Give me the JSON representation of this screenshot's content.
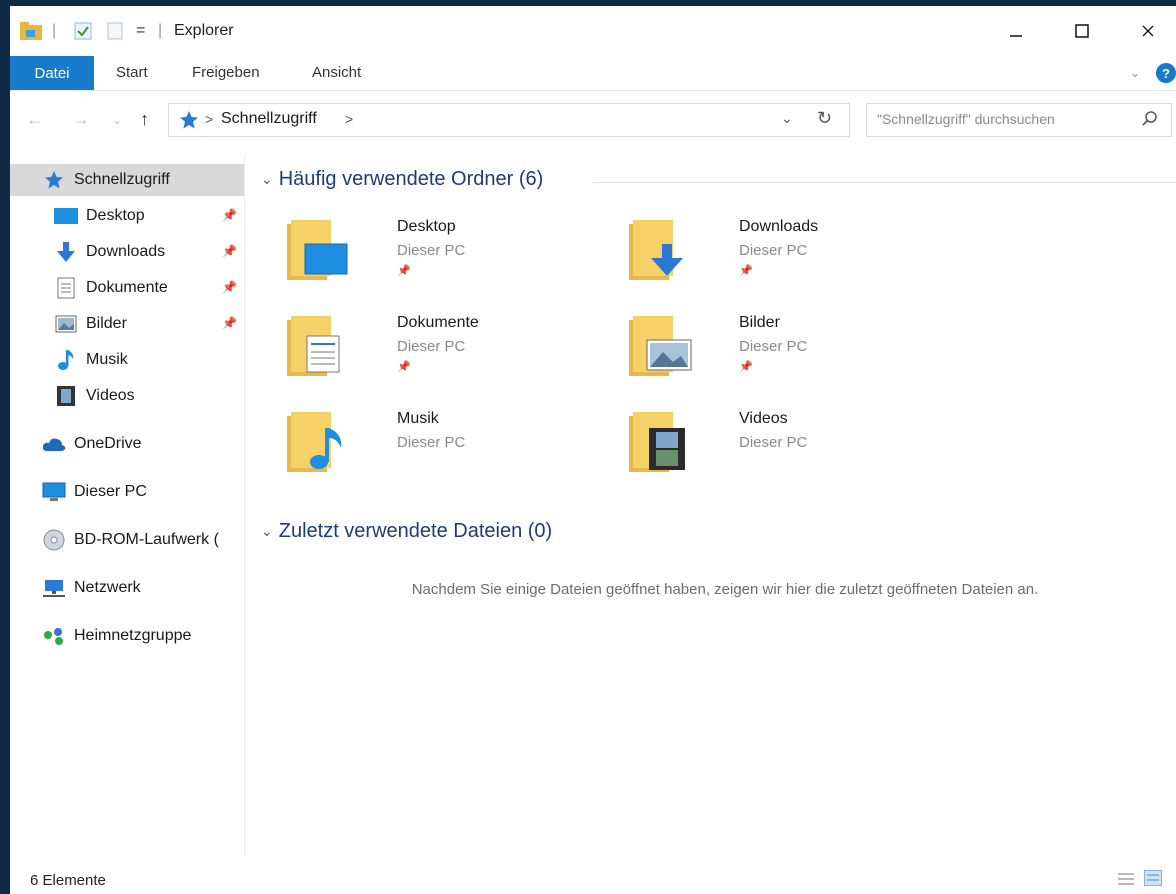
{
  "window": {
    "title": "Explorer"
  },
  "ribbon": {
    "tabs": [
      "Datei",
      "Start",
      "Freigeben",
      "Ansicht"
    ],
    "help_label": "?"
  },
  "address": {
    "path": "Schnellzugriff",
    "separator": ">",
    "search_placeholder": "\"Schnellzugriff\" durchsuchen"
  },
  "sidebar": {
    "items": [
      {
        "label": "Schnellzugriff",
        "icon": "star-icon",
        "pinned": false
      },
      {
        "label": "Desktop",
        "icon": "desktop-icon",
        "pinned": true
      },
      {
        "label": "Downloads",
        "icon": "download-icon",
        "pinned": true
      },
      {
        "label": "Dokumente",
        "icon": "document-icon",
        "pinned": true
      },
      {
        "label": "Bilder",
        "icon": "image-icon",
        "pinned": true
      },
      {
        "label": "Musik",
        "icon": "music-icon",
        "pinned": false
      },
      {
        "label": "Videos",
        "icon": "video-icon",
        "pinned": false
      },
      {
        "label": "OneDrive",
        "icon": "cloud-icon",
        "pinned": false
      },
      {
        "label": "Dieser PC",
        "icon": "computer-icon",
        "pinned": false
      },
      {
        "label": "BD-ROM-Laufwerk (",
        "icon": "disc-icon",
        "pinned": false
      },
      {
        "label": "Netzwerk",
        "icon": "network-icon",
        "pinned": false
      },
      {
        "label": "Heimnetzgruppe",
        "icon": "homegroup-icon",
        "pinned": false
      }
    ]
  },
  "content": {
    "frequent_header": "Häufig verwendete Ordner (6)",
    "recent_header": "Zuletzt verwendete Dateien (0)",
    "empty_message": "Nachdem Sie einige Dateien geöffnet haben, zeigen wir hier die zuletzt geöffneten Dateien an.",
    "folders": [
      {
        "name": "Desktop",
        "location": "Dieser PC",
        "pinned": true
      },
      {
        "name": "Downloads",
        "location": "Dieser PC",
        "pinned": true
      },
      {
        "name": "Dokumente",
        "location": "Dieser PC",
        "pinned": true
      },
      {
        "name": "Bilder",
        "location": "Dieser PC",
        "pinned": true
      },
      {
        "name": "Musik",
        "location": "Dieser PC",
        "pinned": false
      },
      {
        "name": "Videos",
        "location": "Dieser PC",
        "pinned": false
      }
    ]
  },
  "status": {
    "item_count": "6 Elemente"
  },
  "colors": {
    "accent": "#1979ca",
    "header_text": "#1e3b7a",
    "folder": "#f6d168"
  }
}
